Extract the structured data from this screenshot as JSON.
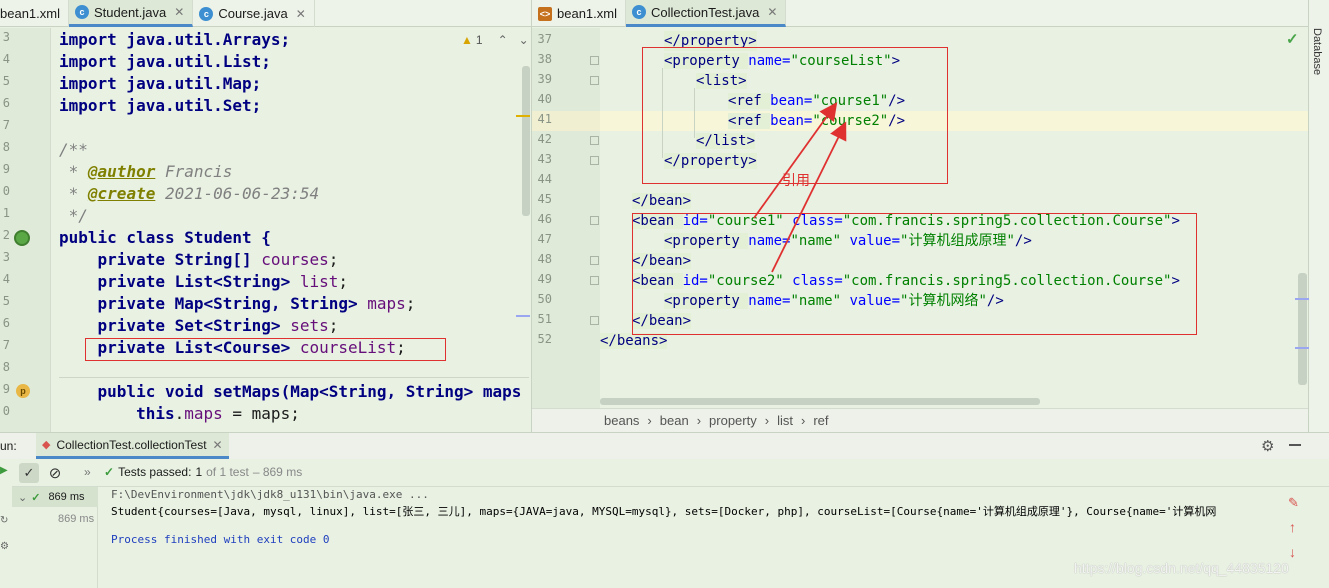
{
  "left_tabs": [
    {
      "label": "bean1.xml",
      "icon": "xml-file-icon"
    },
    {
      "label": "Student.java",
      "icon": "java-class-icon"
    },
    {
      "label": "Course.java",
      "icon": "java-class-icon"
    }
  ],
  "right_tabs": [
    {
      "label": "bean1.xml",
      "icon": "xml-file-icon"
    },
    {
      "label": "CollectionTest.java",
      "icon": "java-class-icon"
    }
  ],
  "left_editor": {
    "warning_count": "1",
    "line_numbers": [
      "3",
      "4",
      "5",
      "6",
      "7",
      "8",
      "9",
      "0",
      "1",
      "2",
      "3",
      "4",
      "5",
      "6",
      "7",
      "8",
      "9",
      "0"
    ],
    "lines": {
      "l3": "import java.util.Arrays;",
      "l4": "import java.util.List;",
      "l5": "import java.util.Map;",
      "l6": "import java.util.Set;",
      "l8": "/**",
      "l9a": " * ",
      "l9b": "@author",
      "l9c": " Francis",
      "l10a": " * ",
      "l10b": "@create",
      "l10c": " 2021-06-06-23:54",
      "l11": " */",
      "l12a": "public class",
      "l12b": " Student {",
      "l13a": "    private",
      "l13b": " String[] ",
      "l13c": "courses",
      "l13d": ";",
      "l14a": "    private",
      "l14b": " List<String> ",
      "l14c": "list",
      "l14d": ";",
      "l15a": "    private",
      "l15b": " Map<String, String> ",
      "l15c": "maps",
      "l15d": ";",
      "l16a": "    private",
      "l16b": " Set<String> ",
      "l16c": "sets",
      "l16d": ";",
      "l17a": "    private",
      "l17b": " List<Course> ",
      "l17c": "courseList",
      "l17d": ";",
      "l19a": "    public void",
      "l19b": " setMaps(Map<String, String> maps",
      "l20a": "        this",
      "l20b": ".",
      "l20c": "maps",
      "l20d": " = maps;"
    }
  },
  "right_editor": {
    "line_numbers": [
      "37",
      "38",
      "39",
      "40",
      "41",
      "42",
      "43",
      "44",
      "45",
      "46",
      "47",
      "48",
      "49",
      "50",
      "51",
      "52"
    ],
    "xml": {
      "r37": "</property>",
      "r38a": "<property ",
      "r38b": "name=",
      "r38c": "\"courseList\"",
      "r38d": ">",
      "r39": "<list>",
      "r40a": "<ref ",
      "r40b": "bean=",
      "r40c": "\"course1\"",
      "r40d": "/>",
      "r41a": "<ref ",
      "r41b": "bean=",
      "r41c": "\"course2\"",
      "r41d": "/>",
      "r42": "</list>",
      "r43": "</property>",
      "r45": "</bean>",
      "r46a": "<bean ",
      "r46b": "id=",
      "r46c": "\"course1\"",
      "r46d": " class=",
      "r46e": "\"com.francis.spring5.collection.Course\"",
      "r46f": ">",
      "r47a": "<property ",
      "r47b": "name=",
      "r47c": "\"name\"",
      "r47d": " value=",
      "r47e": "\"计算机组成原理\"",
      "r47f": "/>",
      "r48": "</bean>",
      "r49a": "<bean ",
      "r49b": "id=",
      "r49c": "\"course2\"",
      "r49d": " class=",
      "r49e": "\"com.francis.spring5.collection.Course\"",
      "r49f": ">",
      "r50a": "<property ",
      "r50b": "name=",
      "r50c": "\"name\"",
      "r50d": " value=",
      "r50e": "\"计算机网络\"",
      "r50f": "/>",
      "r51": "</bean>",
      "r52": "</beans>"
    },
    "annotation_label": "引用",
    "breadcrumb": [
      "beans",
      "bean",
      "property",
      "list",
      "ref"
    ]
  },
  "side_panel": {
    "label": "Database"
  },
  "run_panel": {
    "run_label": "un:",
    "config_tab": "CollectionTest.collectionTest",
    "tests_passed_label": "Tests passed:",
    "tests_passed_count": "1",
    "tests_total": "of 1 test",
    "tests_duration": "– 869 ms",
    "tree_rows": [
      {
        "time": "869 ms"
      },
      {
        "time": "869 ms"
      }
    ],
    "console_lines": [
      "F:\\DevEnvironment\\jdk\\jdk8_u131\\bin\\java.exe ...",
      "Student{courses=[Java, mysql, linux], list=[张三, 三儿], maps={JAVA=java, MYSQL=mysql}, sets=[Docker, php], courseList=[Course{name='计算机组成原理'}, Course{name='计算机网",
      "",
      "Process finished with exit code 0"
    ],
    "watermark": "https://blog.csdn.net/qq_44835120"
  },
  "colors": {
    "editor_bg": "#e8f1e2",
    "highlight_box": "#e03131",
    "keyword": "#000080",
    "string": "#008000",
    "field": "#660e7a"
  }
}
